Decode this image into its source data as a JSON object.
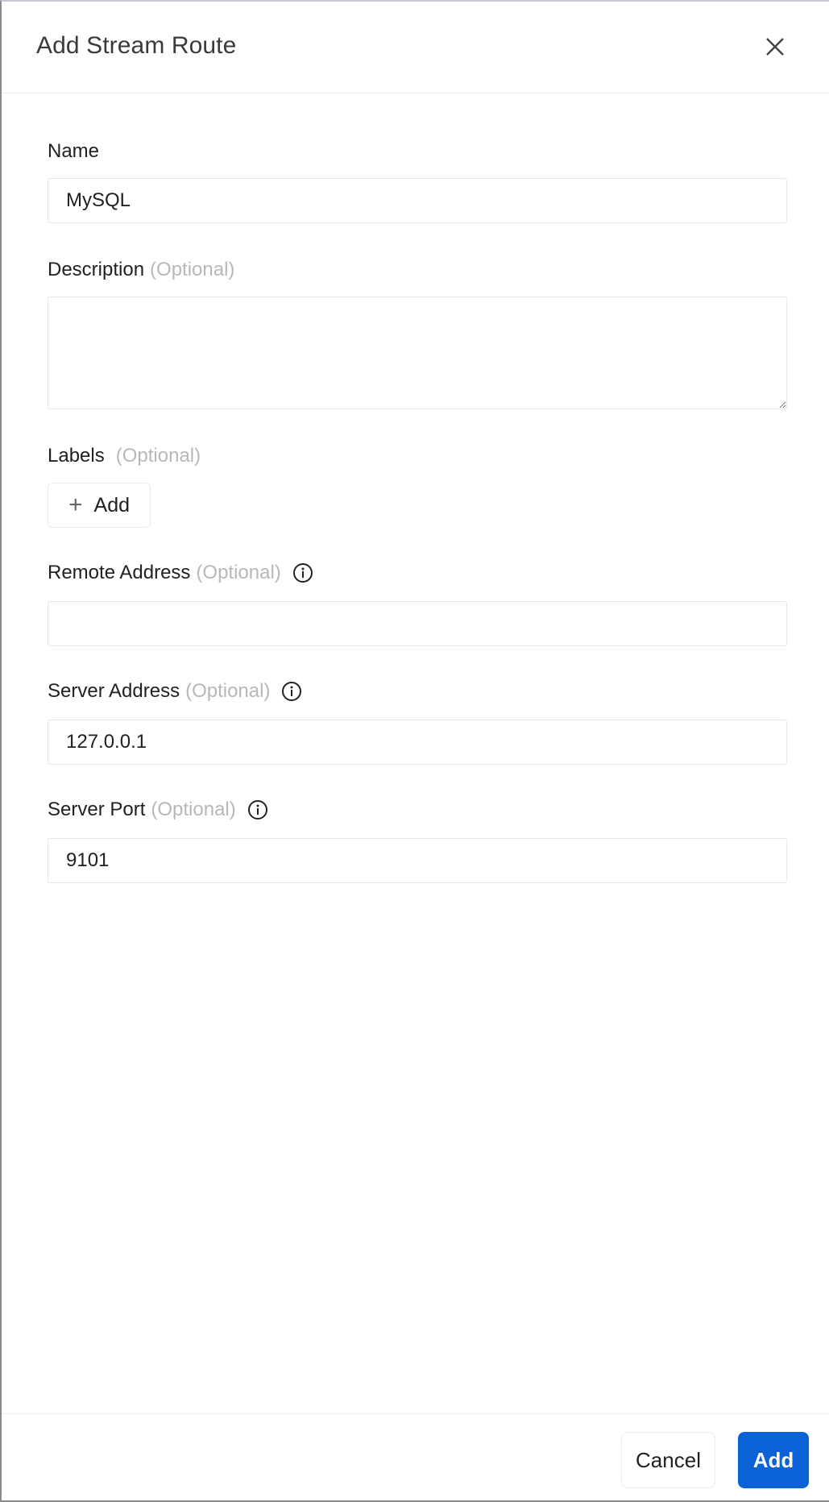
{
  "drawer": {
    "title": "Add Stream Route",
    "close_icon": "close-icon"
  },
  "form": {
    "name": {
      "label": "Name",
      "value": "MySQL"
    },
    "description": {
      "label": "Description",
      "optional": "(Optional)",
      "value": ""
    },
    "labels": {
      "label": "Labels",
      "optional": "(Optional)",
      "add_button": "Add",
      "add_icon": "plus-icon"
    },
    "remote_address": {
      "label": "Remote Address",
      "optional": "(Optional)",
      "value": "",
      "info_icon": "info-icon"
    },
    "server_address": {
      "label": "Server Address",
      "optional": "(Optional)",
      "value": "127.0.0.1",
      "info_icon": "info-icon"
    },
    "server_port": {
      "label": "Server Port",
      "optional": "(Optional)",
      "value": "9101",
      "info_icon": "info-icon"
    }
  },
  "footer": {
    "cancel_label": "Cancel",
    "submit_label": "Add"
  },
  "colors": {
    "primary": "#0a62d6",
    "optional_text": "#b8b8b8"
  }
}
